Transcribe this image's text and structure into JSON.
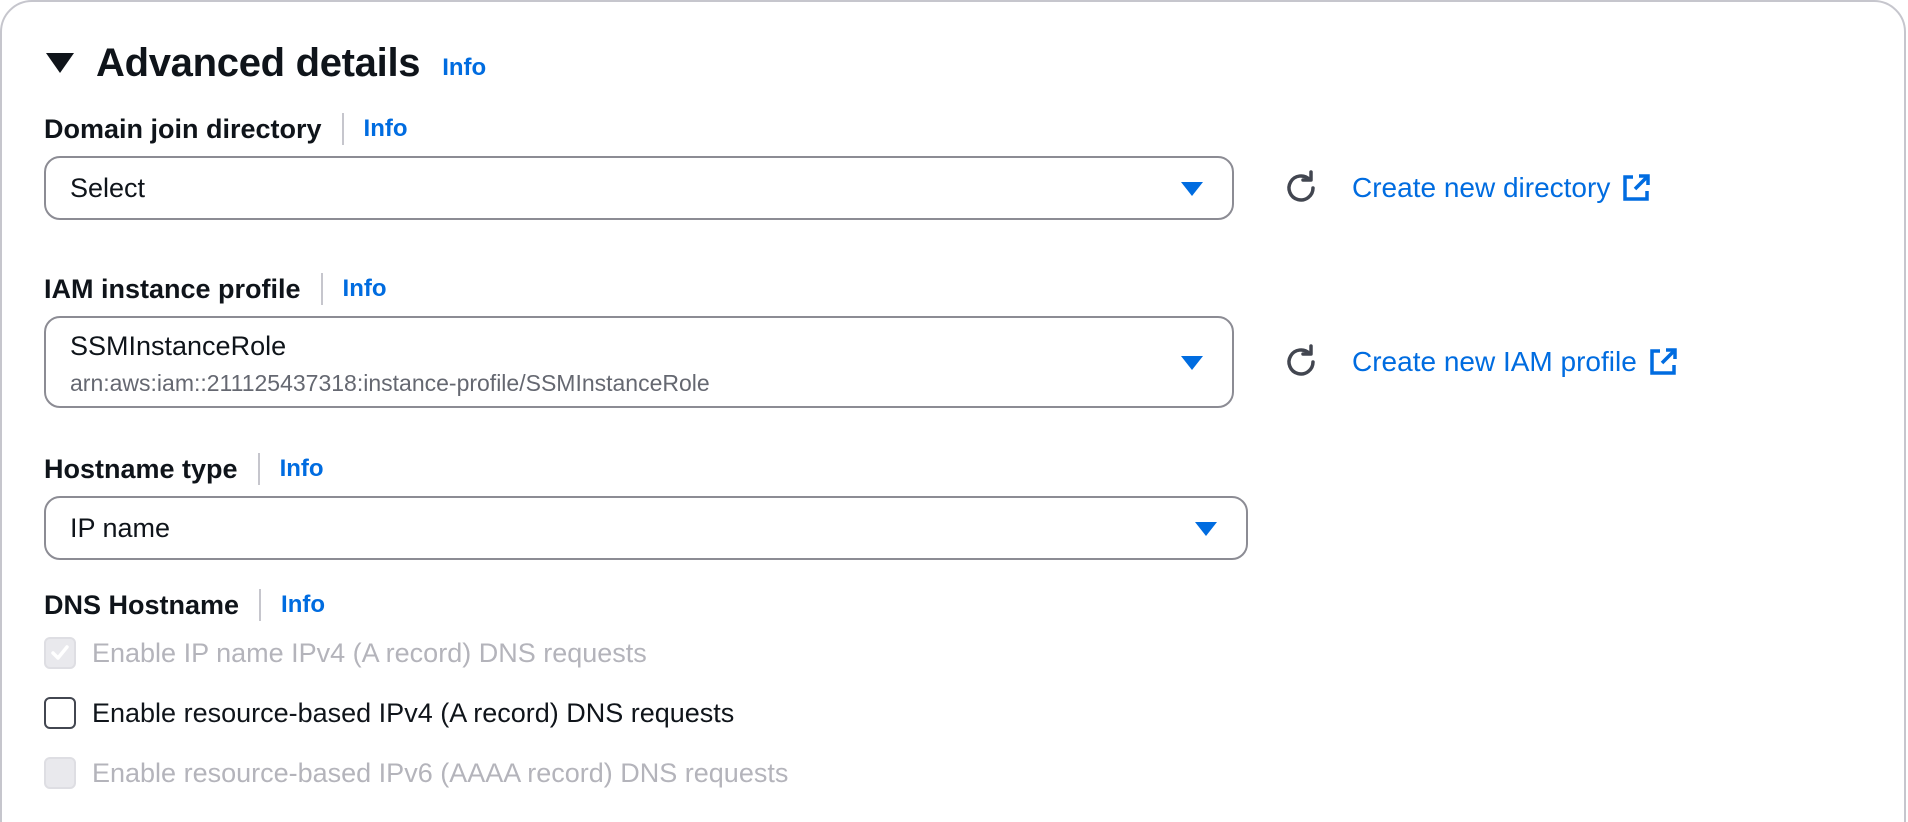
{
  "section": {
    "title": "Advanced details",
    "info": "Info",
    "expanded": true
  },
  "domain_join": {
    "label": "Domain join directory",
    "info": "Info",
    "value": "Select",
    "create_link": "Create new directory"
  },
  "iam_profile": {
    "label": "IAM instance profile",
    "info": "Info",
    "value": "SSMInstanceRole",
    "description": "arn:aws:iam::211125437318:instance-profile/SSMInstanceRole",
    "create_link": "Create new IAM profile"
  },
  "hostname_type": {
    "label": "Hostname type",
    "info": "Info",
    "value": "IP name"
  },
  "dns_hostname": {
    "label": "DNS Hostname",
    "info": "Info",
    "options": [
      {
        "label": "Enable IP name IPv4 (A record) DNS requests",
        "checked": true,
        "disabled": true
      },
      {
        "label": "Enable resource-based IPv4 (A record) DNS requests",
        "checked": false,
        "disabled": false
      },
      {
        "label": "Enable resource-based IPv6 (AAAA record) DNS requests",
        "checked": false,
        "disabled": true
      }
    ]
  },
  "colors": {
    "link": "#006ce0",
    "text": "#0f141a",
    "border": "#8c8c94",
    "disabled_text": "#b4b4bb"
  }
}
